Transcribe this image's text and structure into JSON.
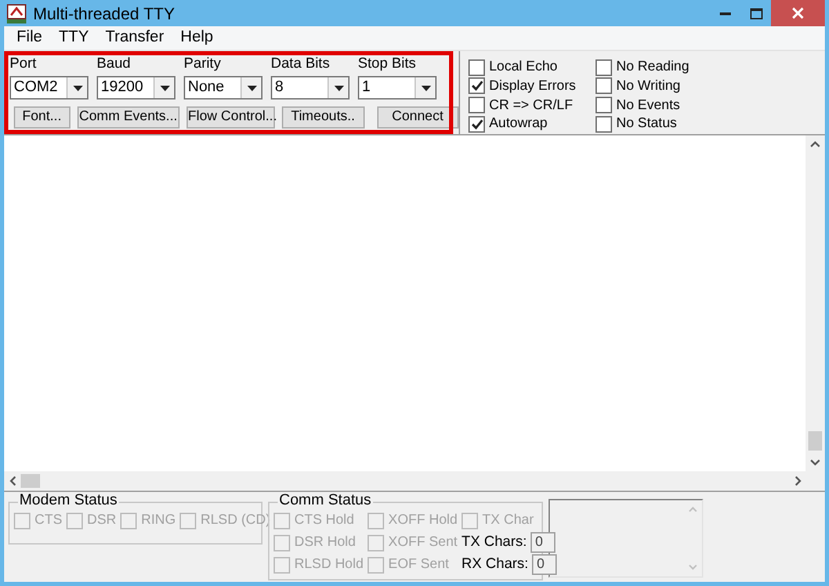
{
  "window": {
    "title": "Multi-threaded TTY"
  },
  "menu": [
    "File",
    "TTY",
    "Transfer",
    "Help"
  ],
  "settings": [
    {
      "label": "Port",
      "value": "COM2"
    },
    {
      "label": "Baud",
      "value": "19200"
    },
    {
      "label": "Parity",
      "value": "None"
    },
    {
      "label": "Data Bits",
      "value": "8"
    },
    {
      "label": "Stop Bits",
      "value": "1"
    }
  ],
  "buttons": [
    "Font...",
    "Comm Events...",
    "Flow Control...",
    "Timeouts..",
    "Connect"
  ],
  "options": [
    {
      "label": "Local Echo",
      "checked": false
    },
    {
      "label": "Display Errors",
      "checked": true
    },
    {
      "label": "CR => CR/LF",
      "checked": false
    },
    {
      "label": "Autowrap",
      "checked": true
    },
    {
      "label": "No Reading",
      "checked": false
    },
    {
      "label": "No Writing",
      "checked": false
    },
    {
      "label": "No Events",
      "checked": false
    },
    {
      "label": "No Status",
      "checked": false
    }
  ],
  "modem_status": {
    "title": "Modem Status",
    "items": [
      {
        "label": "CTS",
        "checked": false,
        "disabled": true
      },
      {
        "label": "DSR",
        "checked": false,
        "disabled": true
      },
      {
        "label": "RING",
        "checked": false,
        "disabled": true
      },
      {
        "label": "RLSD (CD)",
        "checked": false,
        "disabled": true
      }
    ]
  },
  "comm_status": {
    "title": "Comm Status",
    "items": [
      {
        "label": "CTS Hold",
        "checked": false,
        "disabled": true
      },
      {
        "label": "DSR Hold",
        "checked": false,
        "disabled": true
      },
      {
        "label": "RLSD Hold",
        "checked": false,
        "disabled": true
      },
      {
        "label": "XOFF Hold",
        "checked": false,
        "disabled": true
      },
      {
        "label": "XOFF Sent",
        "checked": false,
        "disabled": true
      },
      {
        "label": "EOF Sent",
        "checked": false,
        "disabled": true
      },
      {
        "label": "TX Char",
        "checked": false,
        "disabled": true
      }
    ],
    "counters": [
      {
        "label": "TX Chars:",
        "value": "0"
      },
      {
        "label": "RX Chars:",
        "value": "0"
      }
    ]
  }
}
